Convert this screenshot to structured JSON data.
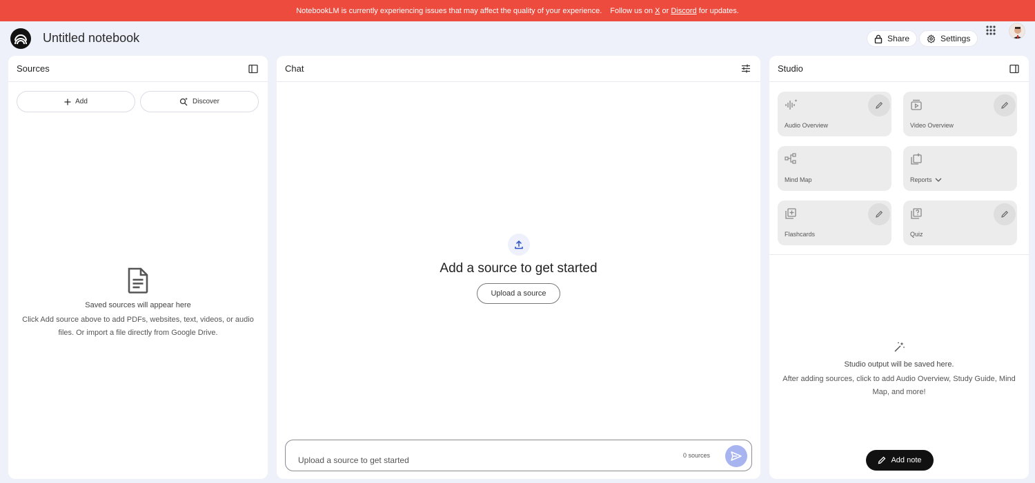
{
  "banner": {
    "message": "NotebookLM is currently experiencing issues that may affect the quality of your experience.",
    "follow_prefix": "Follow us on",
    "x_link": "X",
    "or": "or",
    "discord_link": "Discord",
    "follow_suffix": "for updates.",
    "bg_color": "#ec4b3e"
  },
  "header": {
    "title": "Untitled notebook",
    "share_label": "Share",
    "settings_label": "Settings"
  },
  "sources": {
    "title": "Sources",
    "add_label": "Add",
    "discover_label": "Discover",
    "empty_title": "Saved sources will appear here",
    "empty_desc": "Click Add source above to add PDFs, websites, text, videos, or audio files. Or import a file directly from Google Drive."
  },
  "chat": {
    "title": "Chat",
    "empty_title": "Add a source to get started",
    "upload_button": "Upload a source",
    "input_placeholder": "Upload a source to get started",
    "source_count": "0 sources"
  },
  "studio": {
    "title": "Studio",
    "tiles": [
      {
        "label": "Audio Overview",
        "icon": "audio-wave-icon",
        "editable": true
      },
      {
        "label": "Video Overview",
        "icon": "video-icon",
        "editable": true
      },
      {
        "label": "Mind Map",
        "icon": "mind-map-icon",
        "editable": false
      },
      {
        "label": "Reports",
        "icon": "report-icon",
        "editable": false
      },
      {
        "label": "Flashcards",
        "icon": "flashcards-icon",
        "editable": true
      },
      {
        "label": "Quiz",
        "icon": "quiz-icon",
        "editable": true
      }
    ],
    "empty_title": "Studio output will be saved here.",
    "empty_desc": "After adding sources, click to add Audio Overview, Study Guide, Mind Map, and more!",
    "add_note_label": "Add note"
  },
  "colors": {
    "page_bg": "#eef0fa",
    "send_button": "#a8b4f0",
    "tile_bg": "#ececec"
  }
}
